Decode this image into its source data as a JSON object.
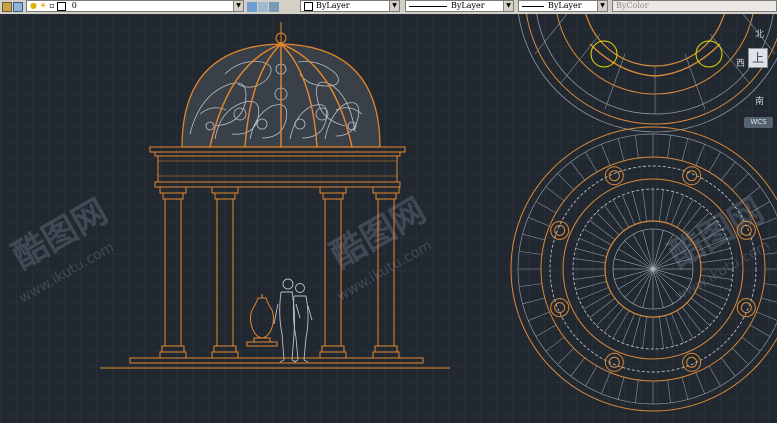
{
  "toolbar": {
    "layer_name": "0",
    "color": "ByLayer",
    "linetype": "ByLayer",
    "lineweight": "ByLayer",
    "plotstyle": "ByColor"
  },
  "viewcube": {
    "north": "北",
    "west": "西",
    "top_face": "上",
    "south": "南",
    "wcs": "WCS"
  },
  "watermarks": [
    "酷图网",
    "www.ikutu.com"
  ],
  "colors": {
    "canvas_bg": "#212830",
    "grid": "#2c3440",
    "drawing_orange": "#e8892b",
    "drawing_gray": "#b9c0c8",
    "plan_outline": "#d98a3a"
  }
}
